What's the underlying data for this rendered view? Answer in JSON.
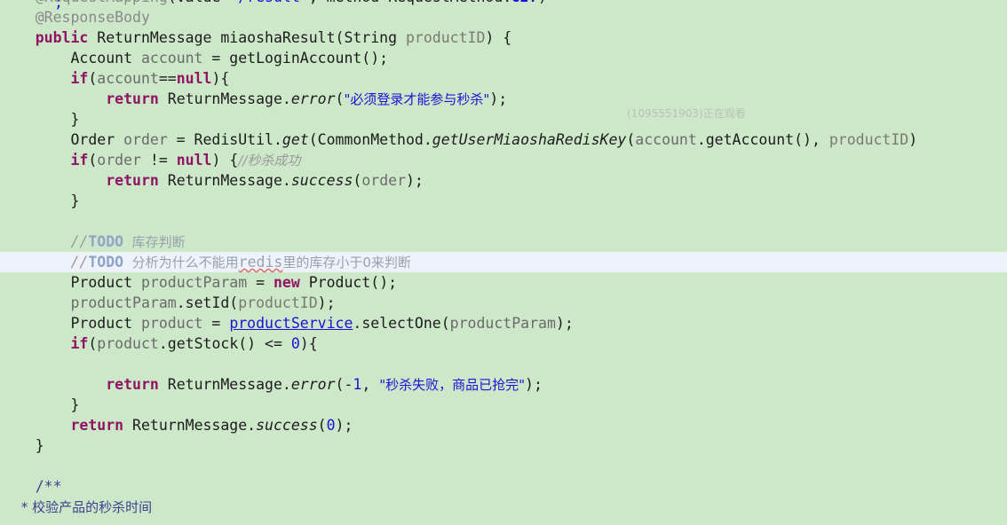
{
  "editor": {
    "background_color": "#cde8c9",
    "current_line_color": "#eef2fb",
    "language": "Java",
    "font_size_px": 16.5,
    "line_height_px": 23,
    "colors": {
      "keyword": "#8f1464",
      "string": "#1a12d6",
      "comment": "#9a9a9a",
      "annotation": "#8a8a8a",
      "identifier": "#6b6b6b",
      "static_field": "#1a12d6",
      "field_reference": "#1a12d6",
      "todo_tag": "#8fa3c8",
      "javadoc": "#3f3f8f"
    }
  },
  "watermark": {
    "text": "(1095551903)正在观看"
  },
  "code": {
    "fragment_above": ";",
    "lines": [
      {
        "n": 1,
        "current": false,
        "tokens": [
          {
            "t": "    ",
            "c": "plain"
          },
          {
            "t": "@RequestMapping",
            "c": "ann"
          },
          {
            "t": "(",
            "c": "plain"
          },
          {
            "t": "value",
            "c": "plain"
          },
          {
            "t": "=",
            "c": "plain"
          },
          {
            "t": "\"/result\"",
            "c": "str"
          },
          {
            "t": ", ",
            "c": "plain"
          },
          {
            "t": "method",
            "c": "plain"
          },
          {
            "t": "=",
            "c": "plain"
          },
          {
            "t": "RequestMethod",
            "c": "plain"
          },
          {
            "t": ".",
            "c": "plain"
          },
          {
            "t": "GET",
            "c": "stfield"
          },
          {
            "t": ")",
            "c": "plain"
          }
        ]
      },
      {
        "n": 2,
        "current": false,
        "tokens": [
          {
            "t": "    ",
            "c": "plain"
          },
          {
            "t": "@ResponseBody",
            "c": "ann"
          }
        ]
      },
      {
        "n": 3,
        "current": false,
        "tokens": [
          {
            "t": "    ",
            "c": "plain"
          },
          {
            "t": "public",
            "c": "kw"
          },
          {
            "t": " ReturnMessage miaoshaResult(String ",
            "c": "plain"
          },
          {
            "t": "productID",
            "c": "param"
          },
          {
            "t": ") {",
            "c": "plain"
          }
        ]
      },
      {
        "n": 4,
        "current": false,
        "tokens": [
          {
            "t": "        Account ",
            "c": "plain"
          },
          {
            "t": "account",
            "c": "ident"
          },
          {
            "t": " = getLoginAccount();",
            "c": "plain"
          }
        ]
      },
      {
        "n": 5,
        "current": false,
        "tokens": [
          {
            "t": "        ",
            "c": "plain"
          },
          {
            "t": "if",
            "c": "kw"
          },
          {
            "t": "(",
            "c": "plain"
          },
          {
            "t": "account",
            "c": "ident"
          },
          {
            "t": "==",
            "c": "plain"
          },
          {
            "t": "null",
            "c": "kw"
          },
          {
            "t": "){",
            "c": "plain"
          }
        ]
      },
      {
        "n": 6,
        "current": false,
        "tokens": [
          {
            "t": "            ",
            "c": "plain"
          },
          {
            "t": "return",
            "c": "kw"
          },
          {
            "t": " ReturnMessage.",
            "c": "plain"
          },
          {
            "t": "error",
            "c": "mth"
          },
          {
            "t": "(",
            "c": "plain"
          },
          {
            "t": "\"必须登录才能参与秒杀\"",
            "c": "strcn"
          },
          {
            "t": ");",
            "c": "plain"
          }
        ]
      },
      {
        "n": 7,
        "current": false,
        "tokens": [
          {
            "t": "        }",
            "c": "plain"
          }
        ]
      },
      {
        "n": 8,
        "current": false,
        "tokens": [
          {
            "t": "        Order ",
            "c": "plain"
          },
          {
            "t": "order",
            "c": "ident"
          },
          {
            "t": " = RedisUtil.",
            "c": "plain"
          },
          {
            "t": "get",
            "c": "mth"
          },
          {
            "t": "(CommonMethod.",
            "c": "plain"
          },
          {
            "t": "getUserMiaoshaRedisKey",
            "c": "mth"
          },
          {
            "t": "(",
            "c": "plain"
          },
          {
            "t": "account",
            "c": "ident"
          },
          {
            "t": ".getAccount(), ",
            "c": "plain"
          },
          {
            "t": "productID",
            "c": "param"
          },
          {
            "t": ")",
            "c": "plain"
          }
        ]
      },
      {
        "n": 9,
        "current": false,
        "tokens": [
          {
            "t": "        ",
            "c": "plain"
          },
          {
            "t": "if",
            "c": "kw"
          },
          {
            "t": "(",
            "c": "plain"
          },
          {
            "t": "order",
            "c": "ident"
          },
          {
            "t": " != ",
            "c": "plain"
          },
          {
            "t": "null",
            "c": "kw"
          },
          {
            "t": ") {",
            "c": "plain"
          },
          {
            "t": "//秒杀成功",
            "c": "cmt"
          }
        ]
      },
      {
        "n": 10,
        "current": false,
        "tokens": [
          {
            "t": "            ",
            "c": "plain"
          },
          {
            "t": "return",
            "c": "kw"
          },
          {
            "t": " ReturnMessage.",
            "c": "plain"
          },
          {
            "t": "success",
            "c": "mth"
          },
          {
            "t": "(",
            "c": "plain"
          },
          {
            "t": "order",
            "c": "ident"
          },
          {
            "t": ");",
            "c": "plain"
          }
        ]
      },
      {
        "n": 11,
        "current": false,
        "tokens": [
          {
            "t": "        }",
            "c": "plain"
          }
        ]
      },
      {
        "n": 12,
        "current": false,
        "tokens": [
          {
            "t": "",
            "c": "plain"
          }
        ]
      },
      {
        "n": 13,
        "current": false,
        "tokens": [
          {
            "t": "        ",
            "c": "plain"
          },
          {
            "t": "//",
            "c": "cmt"
          },
          {
            "t": "TODO",
            "c": "todo"
          },
          {
            "t": "  库存判断",
            "c": "todotxt"
          }
        ]
      },
      {
        "n": 14,
        "current": true,
        "tokens": [
          {
            "t": "        ",
            "c": "plain"
          },
          {
            "t": "//",
            "c": "cmt"
          },
          {
            "t": "TODO",
            "c": "todo"
          },
          {
            "t": "  分析为什么不能用",
            "c": "todotxt"
          },
          {
            "t": "redis",
            "c": "todotxt wavy"
          },
          {
            "t": "里的库存小于0来判断",
            "c": "todotxt"
          }
        ]
      },
      {
        "n": 15,
        "current": false,
        "tokens": [
          {
            "t": "        Product ",
            "c": "plain"
          },
          {
            "t": "productParam",
            "c": "ident"
          },
          {
            "t": " = ",
            "c": "plain"
          },
          {
            "t": "new",
            "c": "kw"
          },
          {
            "t": " Product();",
            "c": "plain"
          }
        ]
      },
      {
        "n": 16,
        "current": false,
        "tokens": [
          {
            "t": "        ",
            "c": "plain"
          },
          {
            "t": "productParam",
            "c": "ident"
          },
          {
            "t": ".setId(",
            "c": "plain"
          },
          {
            "t": "productID",
            "c": "param"
          },
          {
            "t": ");",
            "c": "plain"
          }
        ]
      },
      {
        "n": 17,
        "current": false,
        "tokens": [
          {
            "t": "        Product ",
            "c": "plain"
          },
          {
            "t": "product",
            "c": "ident"
          },
          {
            "t": " = ",
            "c": "plain"
          },
          {
            "t": "productService",
            "c": "field"
          },
          {
            "t": ".selectOne(",
            "c": "plain"
          },
          {
            "t": "productParam",
            "c": "ident"
          },
          {
            "t": ");",
            "c": "plain"
          }
        ]
      },
      {
        "n": 18,
        "current": false,
        "tokens": [
          {
            "t": "        ",
            "c": "plain"
          },
          {
            "t": "if",
            "c": "kw"
          },
          {
            "t": "(",
            "c": "plain"
          },
          {
            "t": "product",
            "c": "ident"
          },
          {
            "t": ".getStock() <= ",
            "c": "plain"
          },
          {
            "t": "0",
            "c": "num"
          },
          {
            "t": "){",
            "c": "plain"
          }
        ]
      },
      {
        "n": 19,
        "current": false,
        "tokens": [
          {
            "t": "",
            "c": "plain"
          }
        ]
      },
      {
        "n": 20,
        "current": false,
        "tokens": [
          {
            "t": "            ",
            "c": "plain"
          },
          {
            "t": "return",
            "c": "kw"
          },
          {
            "t": " ReturnMessage.",
            "c": "plain"
          },
          {
            "t": "error",
            "c": "mth"
          },
          {
            "t": "(-",
            "c": "plain"
          },
          {
            "t": "1",
            "c": "num"
          },
          {
            "t": ", ",
            "c": "plain"
          },
          {
            "t": "\"秒杀失败，商品已抢完\"",
            "c": "strcn"
          },
          {
            "t": ");",
            "c": "plain"
          }
        ]
      },
      {
        "n": 21,
        "current": false,
        "tokens": [
          {
            "t": "        }",
            "c": "plain"
          }
        ]
      },
      {
        "n": 22,
        "current": false,
        "tokens": [
          {
            "t": "        ",
            "c": "plain"
          },
          {
            "t": "return",
            "c": "kw"
          },
          {
            "t": " ReturnMessage.",
            "c": "plain"
          },
          {
            "t": "success",
            "c": "mth"
          },
          {
            "t": "(",
            "c": "plain"
          },
          {
            "t": "0",
            "c": "num"
          },
          {
            "t": ");",
            "c": "plain"
          }
        ]
      },
      {
        "n": 23,
        "current": false,
        "tokens": [
          {
            "t": "    }",
            "c": "plain"
          }
        ]
      },
      {
        "n": 24,
        "current": false,
        "tokens": [
          {
            "t": "",
            "c": "plain"
          }
        ]
      },
      {
        "n": 25,
        "current": false,
        "tokens": [
          {
            "t": "    /**",
            "c": "javadoc"
          }
        ]
      },
      {
        "n": 26,
        "current": false,
        "tokens": [
          {
            "t": "     * 校验产品的秒杀时间",
            "c": "javadoc"
          }
        ]
      }
    ]
  }
}
